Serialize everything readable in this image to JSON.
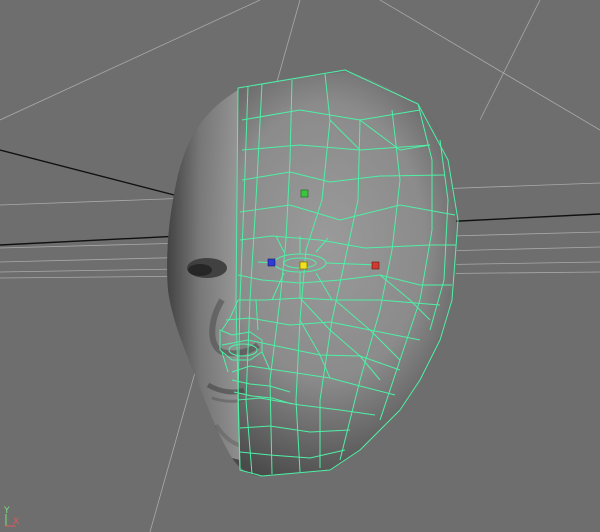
{
  "viewport": {
    "background": "#6e6e6e",
    "grid_color": "#bdbdbd",
    "axis_line_color": "#111111",
    "wireframe_color": "#4ef0a6",
    "mesh_color": "#8a8a8a",
    "mesh_dark_color": "#3c3c3c"
  },
  "manipulator": {
    "handles": [
      {
        "name": "y-handle",
        "color": "#39c63c"
      },
      {
        "name": "x-handle",
        "color": "#d23a2f"
      },
      {
        "name": "z-handle",
        "color": "#2e3bd6"
      },
      {
        "name": "center-handle",
        "color": "#f0e020"
      }
    ]
  },
  "axis_gizmo": {
    "y_label": "Y",
    "x_label": "X",
    "y_color": "#7be07b",
    "x_color": "#e05a5a"
  }
}
